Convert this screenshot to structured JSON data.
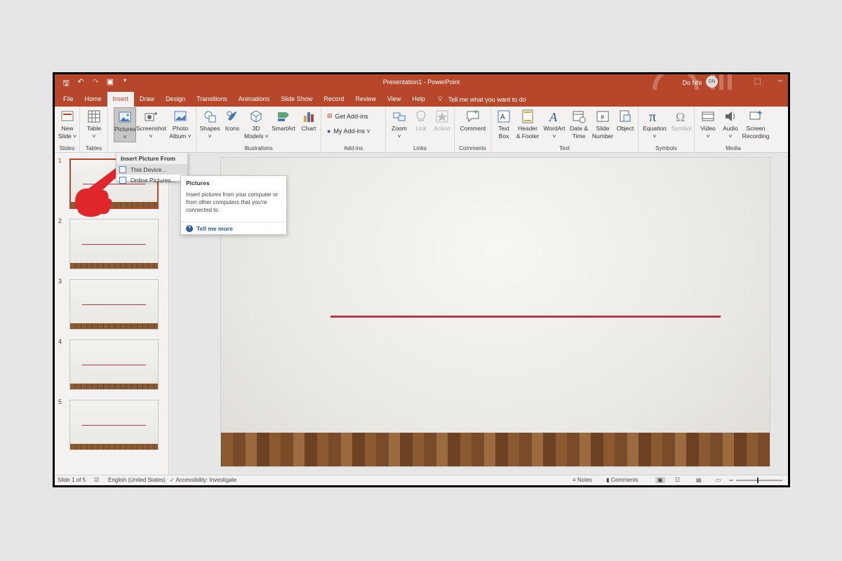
{
  "titlebar": {
    "doc_title": "Presentation1  -  PowerPoint",
    "user_name": "Do Nhi",
    "user_initials": "DN"
  },
  "tabs": [
    "File",
    "Home",
    "Insert",
    "Draw",
    "Design",
    "Transitions",
    "Animations",
    "Slide Show",
    "Record",
    "Review",
    "View",
    "Help"
  ],
  "active_tab": "Insert",
  "tell_me": "Tell me what you want to do",
  "ribbon": {
    "slides": {
      "label": "Slides",
      "new_slide": "New\nSlide ˅"
    },
    "tables": {
      "label": "Tables",
      "table": "Table\n˅"
    },
    "images": {
      "pictures": "Pictures\n˅",
      "screenshot": "Screenshot\n˅",
      "photo_album": "Photo\nAlbum ˅"
    },
    "illustrations": {
      "label": "Illustrations",
      "shapes": "Shapes\n˅",
      "icons": "Icons",
      "models": "3D\nModels ˅",
      "smartart": "SmartArt",
      "chart": "Chart"
    },
    "addins": {
      "label": "Add-ins",
      "get": "Get Add-ins",
      "my": "My Add-ins  ˅"
    },
    "links": {
      "label": "Links",
      "zoom": "Zoom\n˅",
      "link": "Link",
      "action": "Action"
    },
    "comments": {
      "label": "Comments",
      "comment": "Comment"
    },
    "text": {
      "label": "Text",
      "textbox": "Text\nBox",
      "header": "Header\n& Footer",
      "wordart": "WordArt\n˅",
      "datetime": "Date &\nTime",
      "slidenum": "Slide\nNumber",
      "object": "Object"
    },
    "symbols": {
      "label": "Symbols",
      "equation": "Equation\n˅",
      "symbol": "Symbol"
    },
    "media": {
      "label": "Media",
      "video": "Video\n˅",
      "audio": "Audio\n˅",
      "screenrec": "Screen\nRecording"
    }
  },
  "dropdown": {
    "header": "Insert Picture From",
    "items": [
      "This Device...",
      "Online Pictures..."
    ]
  },
  "tooltip": {
    "title": "Pictures",
    "body": "Insert pictures from your computer or from other computers that you're connected to.",
    "link": "Tell me more"
  },
  "slides": [
    "1",
    "2",
    "3",
    "4",
    "5"
  ],
  "status": {
    "slide_of": "Slide 1 of 5",
    "language": "English (United States)",
    "accessibility": "Accessibility: Investigate",
    "notes": "Notes",
    "comments": "Comments"
  },
  "colors": {
    "accent": "#b7472a",
    "line": "#b33a48",
    "hand": "#e0262a"
  },
  "icons": [
    "save-icon",
    "undo-icon",
    "redo-icon",
    "present-icon",
    "lightbulb-icon",
    "help-icon",
    "ribbon-display-icon",
    "minimize-icon"
  ]
}
